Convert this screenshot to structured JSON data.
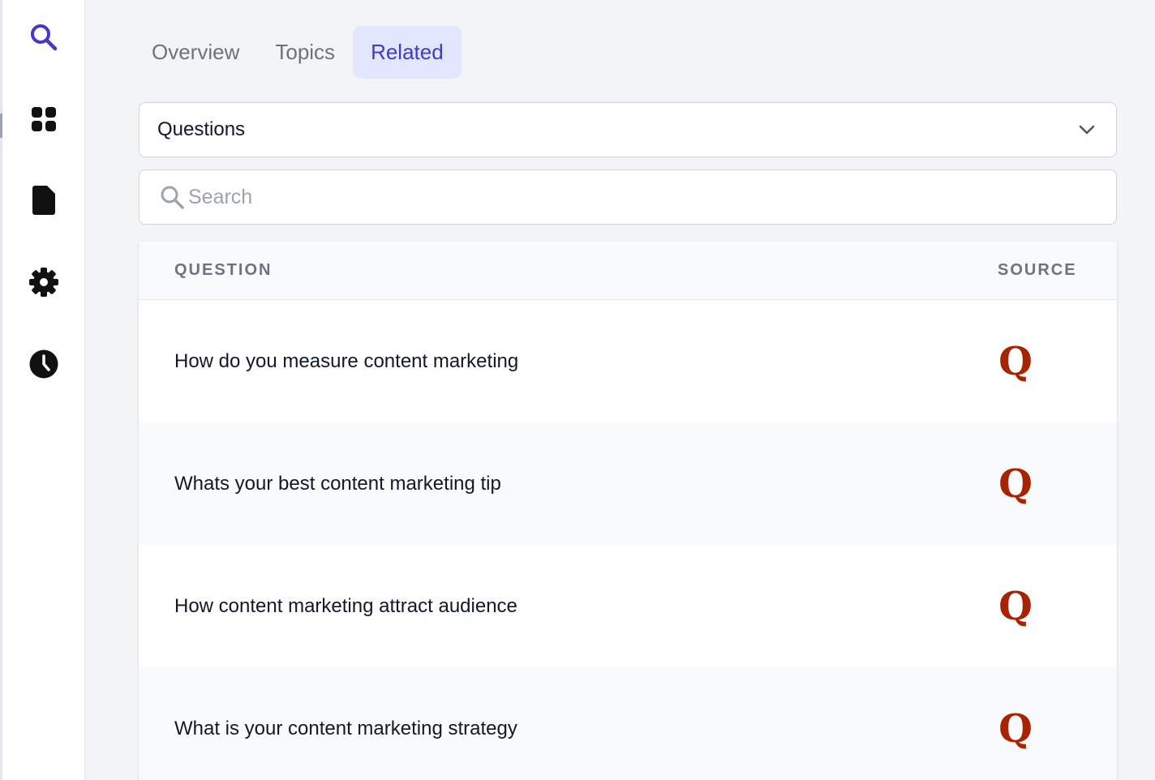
{
  "sidebar": {
    "items": [
      {
        "icon": "search-icon",
        "active": true
      },
      {
        "icon": "grid-icon",
        "active": false
      },
      {
        "icon": "document-icon",
        "active": false
      },
      {
        "icon": "gear-icon",
        "active": false
      },
      {
        "icon": "clock-icon",
        "active": false
      }
    ]
  },
  "tabs": [
    {
      "label": "Overview",
      "active": false
    },
    {
      "label": "Topics",
      "active": false
    },
    {
      "label": "Related",
      "active": true
    }
  ],
  "filter": {
    "selected": "Questions"
  },
  "search": {
    "placeholder": "Search",
    "value": ""
  },
  "table": {
    "headers": {
      "question": "QUESTION",
      "source": "SOURCE"
    },
    "rows": [
      {
        "question": "How do you measure content marketing",
        "source": "Q",
        "source_icon": "quora-icon"
      },
      {
        "question": "Whats your best content marketing tip",
        "source": "Q",
        "source_icon": "quora-icon"
      },
      {
        "question": "How content marketing attract audience",
        "source": "Q",
        "source_icon": "quora-icon"
      },
      {
        "question": "What is your content marketing strategy",
        "source": "Q",
        "source_icon": "quora-icon"
      }
    ]
  },
  "colors": {
    "accent": "#4338ca",
    "tab_active_bg": "#e0e7ff",
    "quora_red": "#a82400",
    "icon_dark": "#111111"
  }
}
